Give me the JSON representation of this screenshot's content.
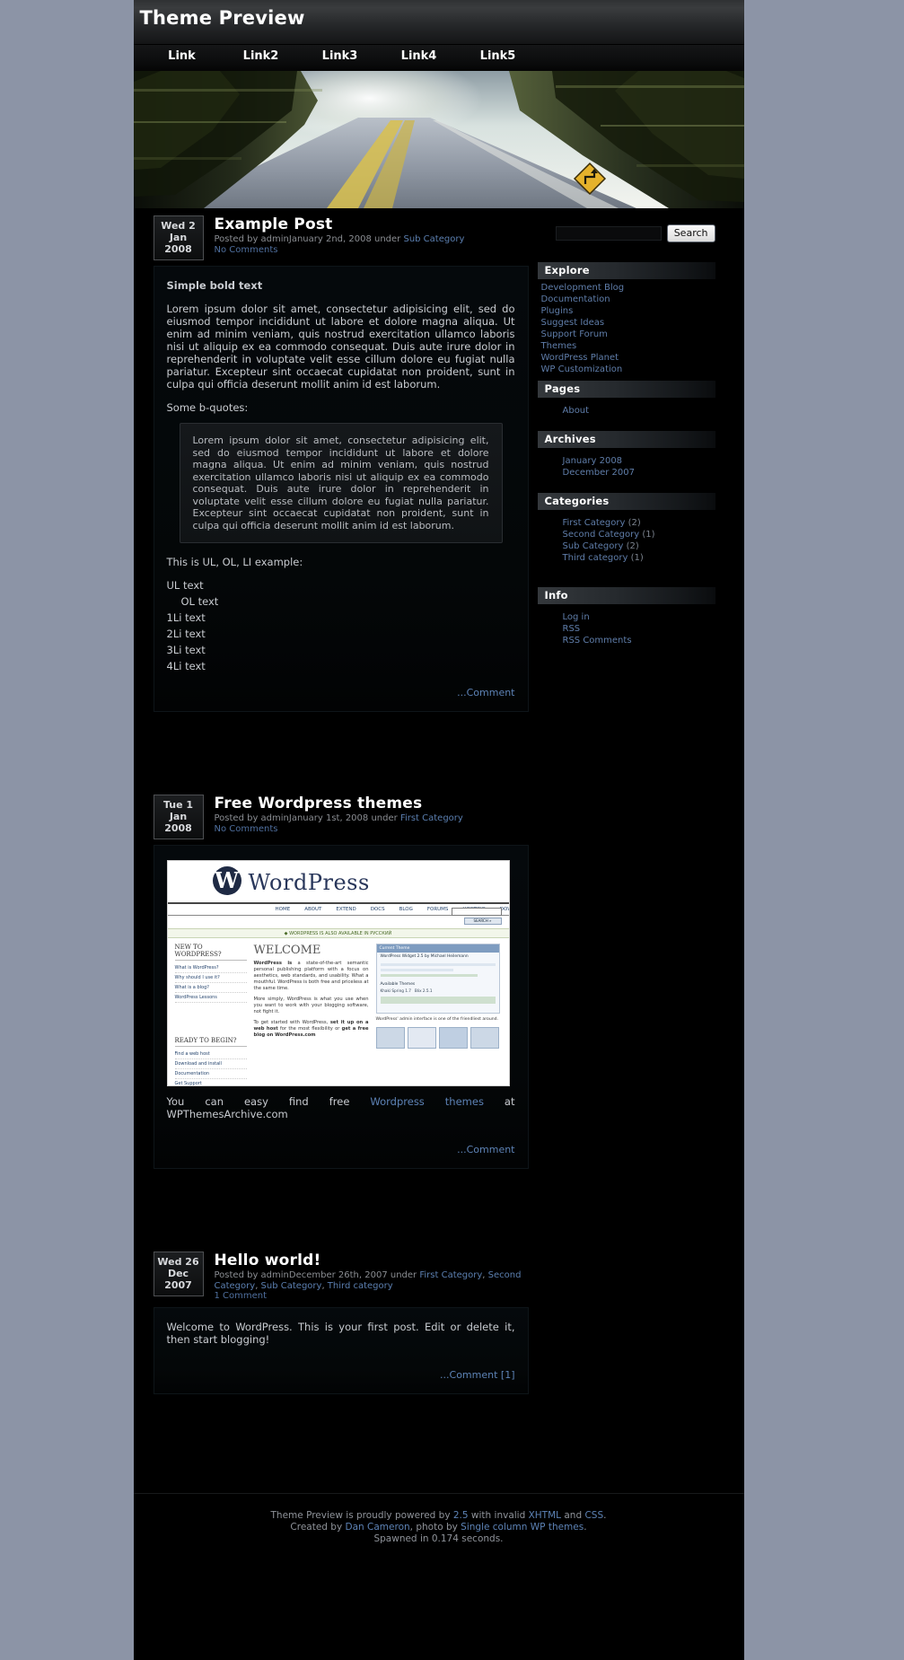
{
  "header": {
    "blog_title": "Theme Preview",
    "nav": [
      {
        "label": "Link"
      },
      {
        "label": "Link2"
      },
      {
        "label": "Link3"
      },
      {
        "label": "Link4"
      },
      {
        "label": "Link5"
      }
    ]
  },
  "hero": {
    "alt": "forest-road-photo"
  },
  "search": {
    "value": "",
    "placeholder": "",
    "button_label": "Search"
  },
  "posts": [
    {
      "date": {
        "dow_day": "Wed 2",
        "month": "Jan",
        "year": "2008"
      },
      "title": "Example Post",
      "meta_prefix": "Posted by adminJanuary 2nd, 2008 under ",
      "categories": [
        "Sub Category"
      ],
      "comments_label": "No Comments",
      "bold_lead": "Simple bold text",
      "paragraph": "Lorem ipsum dolor sit amet, consectetur adipisicing elit, sed do eiusmod tempor incididunt ut labore et dolore magna aliqua. Ut enim ad minim veniam, quis nostrud exercitation ullamco laboris nisi ut aliquip ex ea commodo consequat. Duis aute irure dolor in reprehenderit in voluptate velit esse cillum dolore eu fugiat nulla pariatur. Excepteur sint occaecat cupidatat non proident, sunt in culpa qui officia deserunt mollit anim id est laborum.",
      "quote_intro": "Some b-quotes:",
      "blockquote": "Lorem ipsum dolor sit amet, consectetur adipisicing elit, sed do eiusmod tempor incididunt ut labore et dolore magna aliqua. Ut enim ad minim veniam, quis nostrud exercitation ullamco laboris nisi ut aliquip ex ea commodo consequat. Duis aute irure dolor in reprehenderit in voluptate velit esse cillum dolore eu fugiat nulla pariatur. Excepteur sint occaecat cupidatat non proident, sunt in culpa qui officia deserunt mollit anim id est laborum.",
      "list_intro": "This is UL, OL, LI example:",
      "ul_text": "UL text",
      "ol_text": "OL text",
      "li_items": [
        "1Li text",
        "2Li text",
        "3Li text",
        "4Li text"
      ],
      "comment_link": "...Comment"
    },
    {
      "date": {
        "dow_day": "Tue 1",
        "month": "Jan",
        "year": "2008"
      },
      "title": "Free Wordpress themes",
      "meta_prefix": "Posted by adminJanuary 1st, 2008 under ",
      "categories": [
        "First Category"
      ],
      "comments_label": "No Comments",
      "caption_before": "You can easy find free ",
      "caption_link": "Wordpress themes",
      "caption_after": " at WPThemesArchive.com",
      "comment_link": "...Comment",
      "screenshot": {
        "brand": "WordPress",
        "logo_letter": "W",
        "nav": [
          "HOME",
          "ABOUT",
          "EXTEND",
          "DOCS",
          "BLOG",
          "FORUMS",
          "HOSTING",
          "DOWNLOAD"
        ],
        "search_button": "SEARCH »",
        "ribbon": "◆ WORDPRESS IS ALSO AVAILABLE IN РУССКИЙ",
        "col1_head1": "NEW TO WORDPRESS?",
        "col1_links1": [
          "What is WordPress?",
          "Why should I use it?",
          "What is a blog?",
          "WordPress Lessons"
        ],
        "col1_head2": "READY TO BEGIN?",
        "col1_links2": [
          "Find a web host",
          "Download and install",
          "Documentation",
          "Get Support"
        ],
        "welcome": "WELCOME",
        "para1_bold": "WordPress is",
        "para1": " a state-of-the-art semantic personal publishing platform with a focus on aesthetics, web standards, and usability. What a mouthful. WordPress is both free and priceless at the same time.",
        "para2": "More simply, WordPress is what you use when you want to work with your blogging software, not fight it.",
        "para3_start": "To get started with WordPress, ",
        "para3_b1": "set it up on a web host",
        "para3_mid": " for the most flexibility or ",
        "para3_b2": "get a free blog on WordPress.com",
        "panel_head": "Current Theme",
        "panel_title": "WordPress Widget 2.5 by Michael Heilemann",
        "panel_sub": "Available Themes",
        "panel_a": "Khaki Spring 1.7",
        "panel_b": "Blix 2.5.1",
        "caption": "WordPress' admin interface is one of the friendliest around."
      }
    },
    {
      "date": {
        "dow_day": "Wed 26",
        "month": "Dec",
        "year": "2007"
      },
      "title": "Hello world!",
      "meta_prefix": "Posted by adminDecember 26th, 2007 under ",
      "categories": [
        "First Category",
        "Second Category",
        "Sub Category",
        "Third category"
      ],
      "comments_label": "1 Comment",
      "paragraph": "Welcome to WordPress. This is your first post. Edit or delete it, then start blogging!",
      "comment_link": "...Comment [1]"
    }
  ],
  "sidebar": {
    "explore": {
      "title": "Explore",
      "items": [
        "Development Blog",
        "Documentation",
        "Plugins",
        "Suggest Ideas",
        "Support Forum",
        "Themes",
        "WordPress Planet",
        "WP Customization"
      ]
    },
    "pages": {
      "title": "Pages",
      "items": [
        "About"
      ]
    },
    "archives": {
      "title": "Archives",
      "items": [
        "January 2008",
        "December 2007"
      ]
    },
    "categories": {
      "title": "Categories",
      "items": [
        {
          "label": "First Category",
          "count": "(2)"
        },
        {
          "label": "Second Category",
          "count": "(1)"
        },
        {
          "label": "Sub Category",
          "count": "(2)"
        },
        {
          "label": "Third category",
          "count": "(1)"
        }
      ]
    },
    "info": {
      "title": "Info",
      "items": [
        "Log in",
        "RSS",
        "RSS Comments"
      ]
    }
  },
  "footer": {
    "line1_a": "Theme Preview is proudly powered by ",
    "line1_version": "2.5",
    "line1_b": " with invalid ",
    "line1_xhtml": "XHTML",
    "line1_c": " and ",
    "line1_css": "CSS",
    "line1_d": ".",
    "line2_a": "Created by ",
    "line2_author": "Dan Cameron",
    "line2_b": ", photo by ",
    "line2_photo": "Single column WP themes",
    "line2_c": ".",
    "line3": "Spawned in 0.174 seconds."
  },
  "colors": {
    "page_bg": "#8c94a6",
    "site_bg": "#000000",
    "link": "#5d83b6",
    "muted": "#8a8d92",
    "text": "#c9ccd1"
  }
}
